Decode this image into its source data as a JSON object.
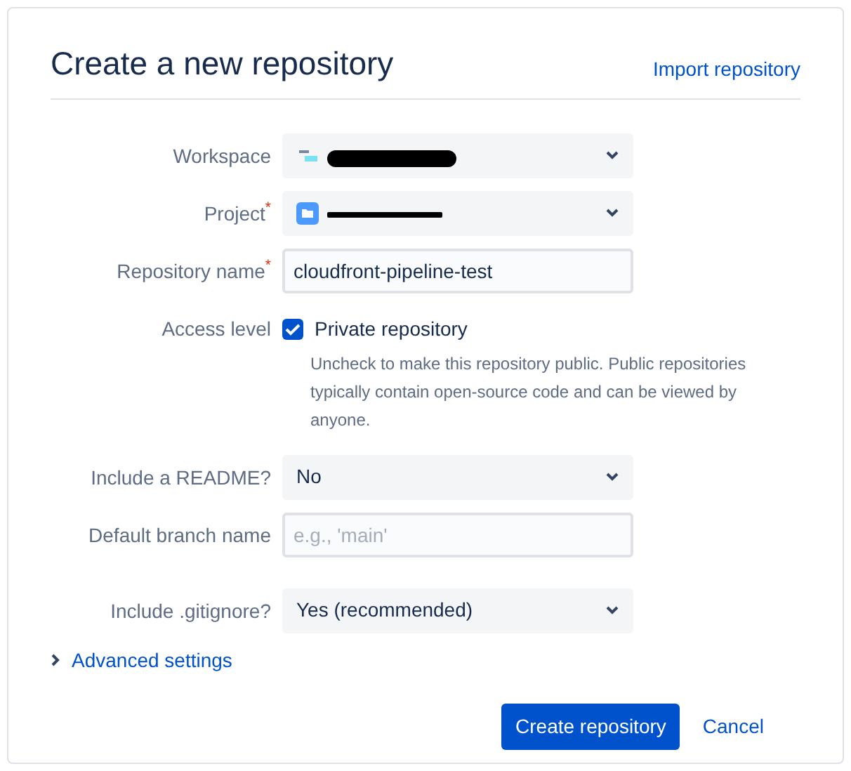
{
  "title": "Create a new repository",
  "import_link": "Import repository",
  "fields": [
    {
      "kind": "workspace",
      "label": "Workspace",
      "redacted": true
    },
    {
      "kind": "project",
      "label": "Project",
      "required_mark": "*",
      "redacted": true
    },
    {
      "kind": "text",
      "label": "Repository name",
      "required_mark": "*",
      "value": "cloudfront-pipeline-test"
    },
    {
      "kind": "checkbox",
      "label": "Access level",
      "option": "Private repository",
      "checked": true,
      "help": "Uncheck to make this repository public. Public repositories typically contain open-source code and can be viewed by anyone."
    },
    {
      "kind": "select",
      "label": "Include a README?",
      "value": "No"
    },
    {
      "kind": "text",
      "label": "Default branch name",
      "placeholder": "e.g., 'main'"
    },
    {
      "kind": "select",
      "label": "Include .gitignore?",
      "value": "Yes (recommended)"
    }
  ],
  "advanced": {
    "label": "Advanced settings",
    "expanded": false
  },
  "buttons": [
    {
      "label": "Create repository",
      "kind": "primary"
    },
    {
      "label": "Cancel",
      "kind": "link"
    }
  ]
}
